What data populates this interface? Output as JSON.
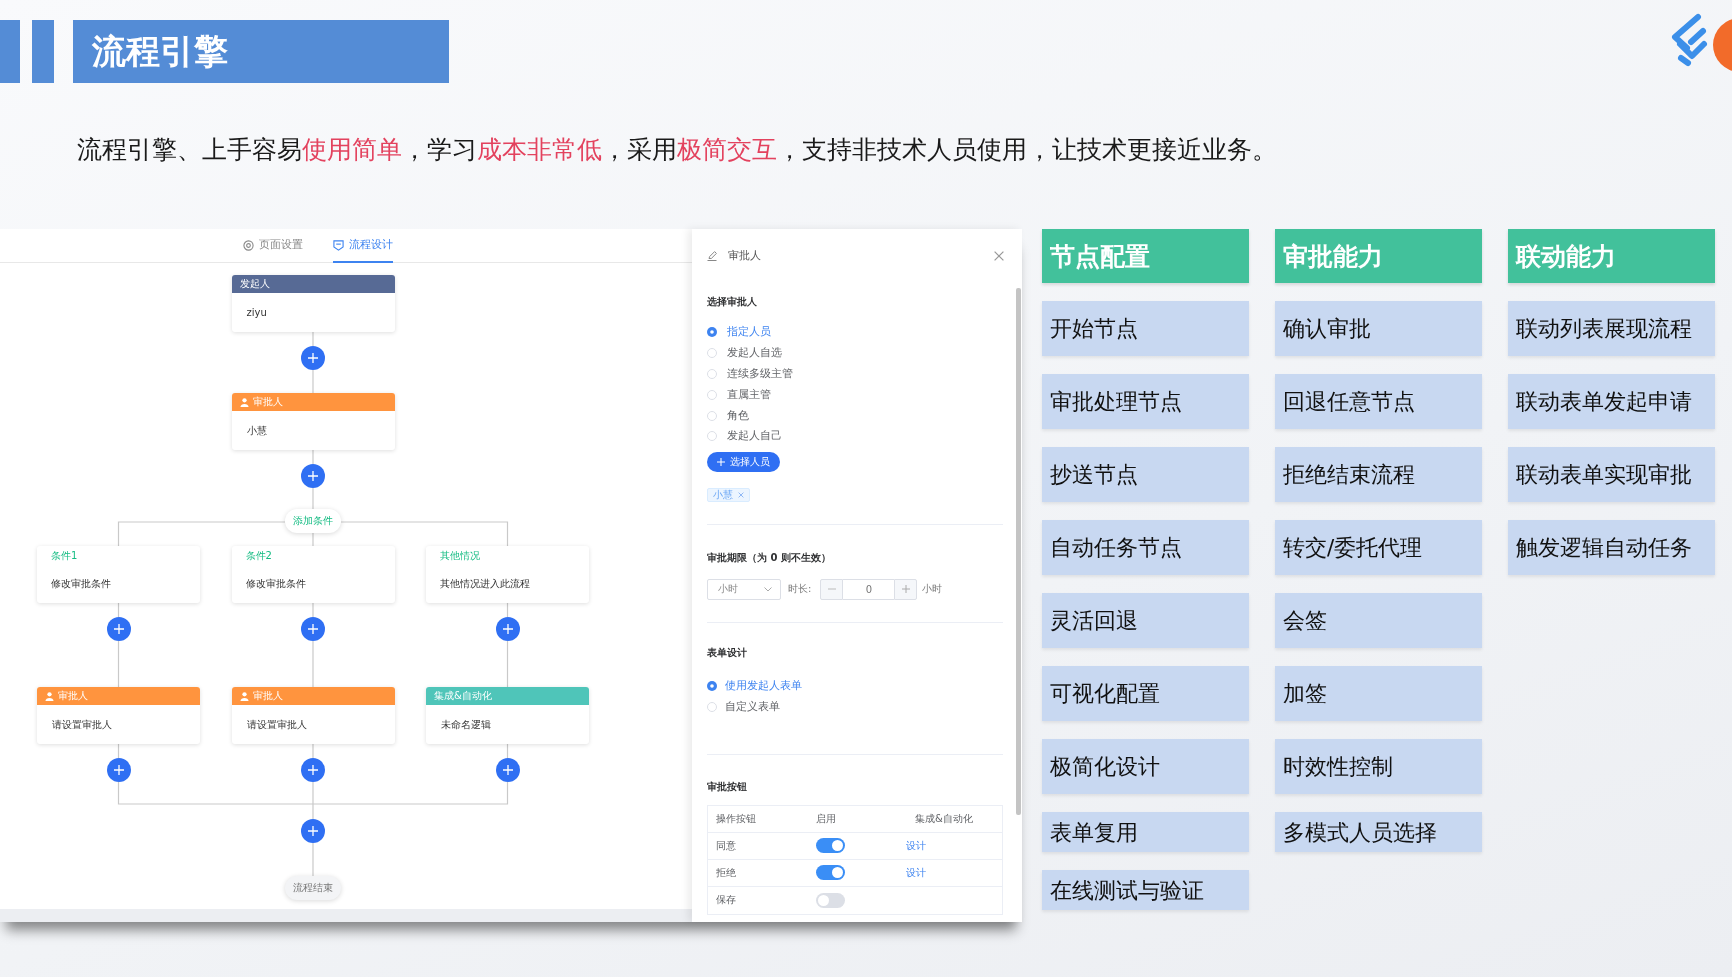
{
  "header": {
    "title": "流程引擎"
  },
  "intro": [
    {
      "text": "流程引擎、上手容易",
      "highlight": false
    },
    {
      "text": "使用简单",
      "highlight": true
    },
    {
      "text": "，学习",
      "highlight": false
    },
    {
      "text": "成本非常低",
      "highlight": true
    },
    {
      "text": "，采用",
      "highlight": false
    },
    {
      "text": "极简交互",
      "highlight": true
    },
    {
      "text": "，支持非技术人员使用，让技术更接近业务。",
      "highlight": false
    }
  ],
  "app": {
    "tabs": [
      {
        "label": "页面设置",
        "selected": false
      },
      {
        "label": "流程设计",
        "selected": true
      }
    ],
    "flow": {
      "nodes": [
        {
          "kind": "start",
          "title": "发起人",
          "content": "ziyu"
        },
        {
          "kind": "approver",
          "title": "审批人",
          "content": "小慧"
        }
      ],
      "add_condition": "添加条件",
      "branches": [
        {
          "condition": {
            "title": "条件1",
            "content": "修改审批条件"
          },
          "node": {
            "kind": "approver",
            "title": "审批人",
            "content": "请设置审批人"
          }
        },
        {
          "condition": {
            "title": "条件2",
            "content": "修改审批条件"
          },
          "node": {
            "kind": "approver",
            "title": "审批人",
            "content": "请设置审批人"
          }
        },
        {
          "condition": {
            "title": "其他情况",
            "content": "其他情况进入此流程"
          },
          "node": {
            "kind": "automation",
            "title": "集成&自动化",
            "content": "未命名逻辑"
          }
        }
      ],
      "end": "流程结束"
    },
    "drawer": {
      "title": "审批人",
      "approver": {
        "heading": "选择审批人",
        "options": [
          {
            "label": "指定人员",
            "selected": true
          },
          {
            "label": "发起人自选",
            "selected": false
          },
          {
            "label": "连续多级主管",
            "selected": false
          },
          {
            "label": "直属主管",
            "selected": false
          },
          {
            "label": "角色",
            "selected": false
          },
          {
            "label": "发起人自己",
            "selected": false
          }
        ],
        "add_button": "选择人员",
        "tags": [
          "小慧"
        ]
      },
      "deadline": {
        "heading": "审批期限（为 0 则不生效）",
        "unit_select": "小时",
        "duration_label": "时长:",
        "duration_value": "0",
        "unit_label": "小时"
      },
      "form": {
        "heading": "表单设计",
        "options": [
          {
            "label": "使用发起人表单",
            "selected": true
          },
          {
            "label": "自定义表单",
            "selected": false
          }
        ]
      },
      "buttons": {
        "heading": "审批按钮",
        "columns": [
          "操作按钮",
          "启用",
          "集成&自动化"
        ],
        "rows": [
          {
            "name": "同意",
            "on": true,
            "action": "设计"
          },
          {
            "name": "拒绝",
            "on": true,
            "action": "设计"
          },
          {
            "name": "保存",
            "on": false
          }
        ]
      }
    }
  },
  "features": [
    {
      "heading": "节点配置",
      "items": [
        "开始节点",
        "审批处理节点",
        "抄送节点",
        "自动任务节点",
        "灵活回退",
        "可视化配置",
        "极简化设计",
        "表单复用",
        "在线测试与验证"
      ]
    },
    {
      "heading": "审批能力",
      "items": [
        "确认审批",
        "回退任意节点",
        "拒绝结束流程",
        "转交/委托代理",
        "会签",
        "加签",
        "时效性控制",
        "多模式人员选择"
      ]
    },
    {
      "heading": "联动能力",
      "items": [
        "联动列表展现流程",
        "联动表单发起申请",
        "联动表单实现审批",
        "触发逻辑自动任务"
      ]
    }
  ]
}
